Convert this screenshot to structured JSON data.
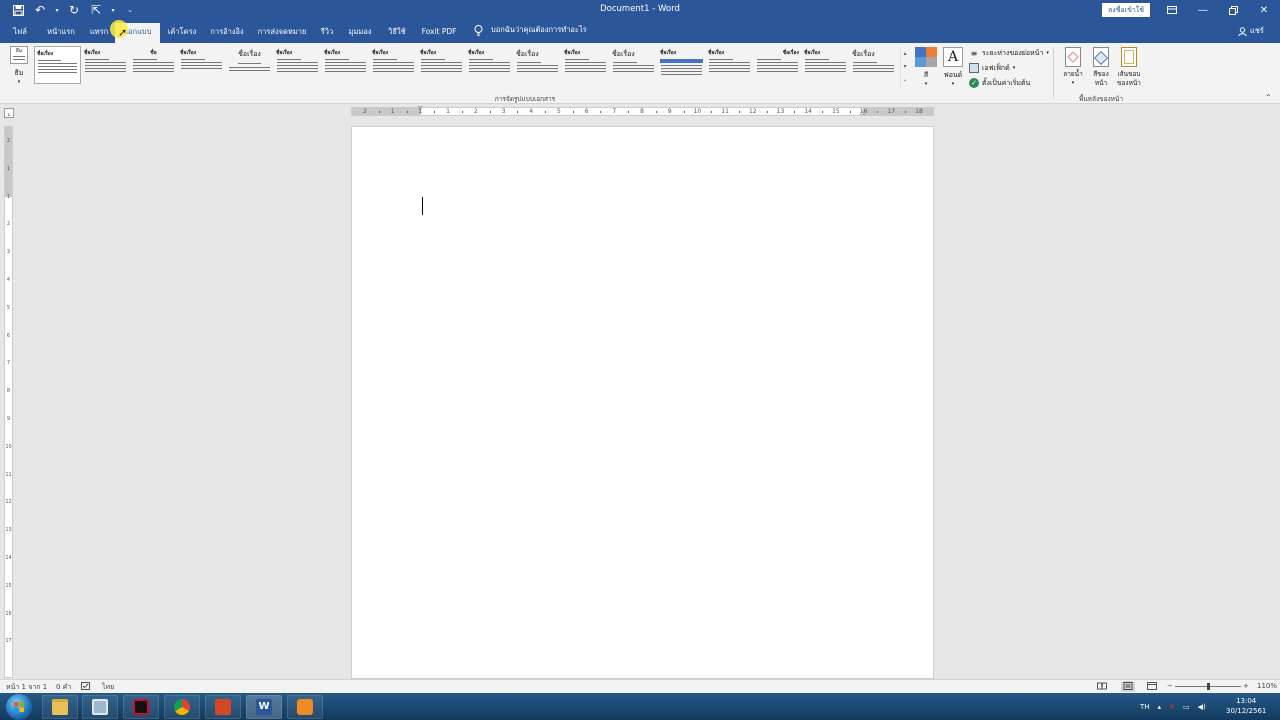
{
  "window": {
    "title": "Document1 - Word",
    "sign_in": "ลงชื่อเข้าใช้",
    "share": "แชร์"
  },
  "tabs": [
    {
      "label": "ไฟล์",
      "active": false
    },
    {
      "label": "หน้าแรก",
      "active": false
    },
    {
      "label": "แทรก",
      "active": false
    },
    {
      "label": "ออกแบบ",
      "active": true
    },
    {
      "label": "เค้าโครง",
      "active": false
    },
    {
      "label": "การอ้างอิง",
      "active": false
    },
    {
      "label": "การส่งจดหมาย",
      "active": false
    },
    {
      "label": "รีวิว",
      "active": false
    },
    {
      "label": "มุมมอง",
      "active": false
    },
    {
      "label": "วิธีใช้",
      "active": false
    },
    {
      "label": "Foxit PDF",
      "active": false
    }
  ],
  "tell_me": "บอกฉันว่าคุณต้องการทำอะไร",
  "ribbon": {
    "themes_label": "ธีม",
    "themes_box": "ธีม",
    "style_titles": [
      "ชื่อเรื่อง",
      "ชื่อเรื่อง",
      "ชื่อ",
      "ชื่อเรื่อง",
      "ชื่อเรื่อง",
      "ชื่อเรื่อง",
      "ชื่อเรื่อง",
      "ชื่อเรื่อง",
      "ชื่อเรื่อง",
      "ชื่อเรื่อง",
      "ชื่อเรื่อง",
      "ชื่อเรื่อง",
      "ชื่อเรื่อง",
      "ชื่อเรื่อง",
      "ชื่อเรื่อง",
      "ชื่อเรื่อง",
      "ชื่อเรื่อง",
      "ชื่อเรื่อง"
    ],
    "document_formatting_group": "การจัดรูปแบบเอกสาร",
    "colors_label": "สี",
    "fonts_label": "ฟอนต์",
    "fonts_glyph": "A",
    "paragraph_spacing": "ระยะห่างของย่อหน้า",
    "effects": "เอฟเฟ็กต์",
    "set_as_default": "ตั้งเป็นค่าเริ่มต้น",
    "watermark_line1": "ลายน้ำ",
    "page_color_line1": "สีของ",
    "page_color_line2": "หน้า",
    "page_borders_line1": "เส้นขอบ",
    "page_borders_line2": "ของหน้า",
    "page_background_group": "พื้นหลังของหน้า",
    "theme_colors": [
      "#4472c4",
      "#ed7d31",
      "#5b9bd5",
      "#a5a5a5"
    ]
  },
  "ruler": {
    "h_numbers": [
      "2",
      "1",
      "1",
      "1",
      "2",
      "3",
      "4",
      "5",
      "6",
      "7",
      "8",
      "9",
      "10",
      "11",
      "12",
      "13",
      "14",
      "15",
      "16",
      "17",
      "18"
    ],
    "v_numbers": [
      "2",
      "1",
      "1",
      "2",
      "3",
      "4",
      "5",
      "6",
      "7",
      "8",
      "9",
      "10",
      "11",
      "12",
      "13",
      "14",
      "15",
      "16",
      "17"
    ]
  },
  "status": {
    "page": "หน้า 1 จาก 1",
    "words": "0 คำ",
    "language": "ไทย",
    "zoom": "110%",
    "zoom_minus": "−",
    "zoom_plus": "+",
    "zoom_position": 0.5
  },
  "taskbar": {
    "input_lang": "TH",
    "time": "13:04",
    "date": "30/12/2561"
  },
  "colors": {
    "accent": "#2b579a"
  }
}
